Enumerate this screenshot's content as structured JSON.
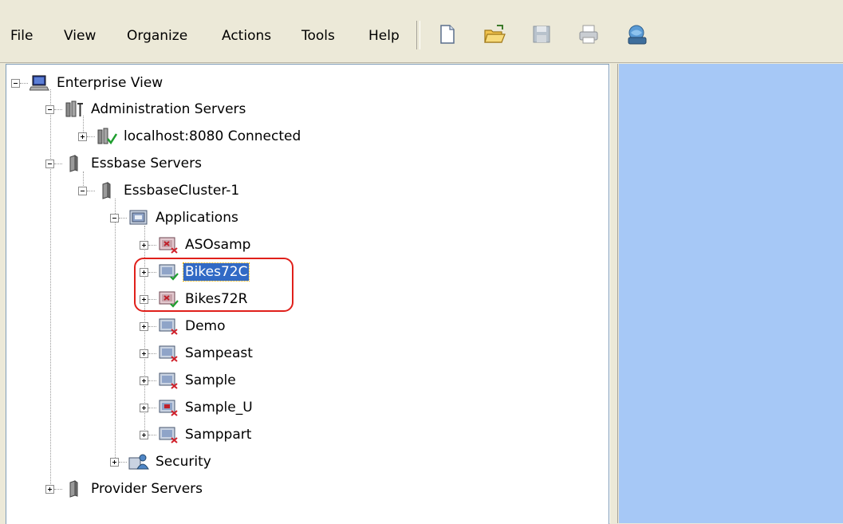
{
  "menu": {
    "file": "File",
    "view": "View",
    "organize": "Organize",
    "actions": "Actions",
    "tools": "Tools",
    "help": "Help"
  },
  "toolbar": {
    "icons": [
      "new-document-icon",
      "open-folder-icon",
      "save-icon",
      "print-icon",
      "connect-server-icon"
    ]
  },
  "tree": {
    "root": "Enterprise View",
    "admin_servers": "Administration Servers",
    "localhost": "localhost:8080 Connected",
    "essbase_servers": "Essbase Servers",
    "cluster": "EssbaseCluster-1",
    "applications": "Applications",
    "apps": [
      "ASOsamp",
      "Bikes72C",
      "Bikes72R",
      "Demo",
      "Sampeast",
      "Sample",
      "Sample_U",
      "Samppart"
    ],
    "security": "Security",
    "provider_servers": "Provider Servers"
  },
  "colors": {
    "selection": "#316AC5",
    "highlight_outline": "#E0201B",
    "right_pane": "#A6C8F6"
  }
}
